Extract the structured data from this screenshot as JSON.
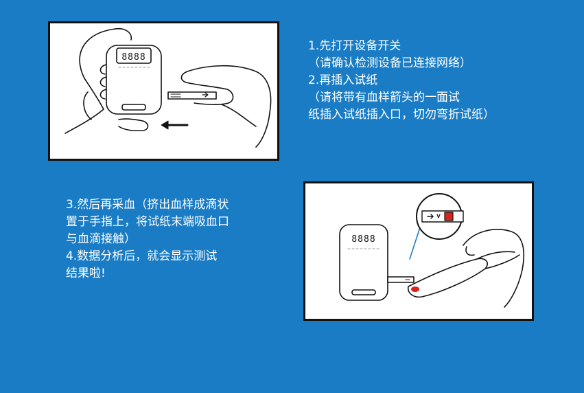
{
  "step_a": {
    "lines": [
      "1.先打开设备开关",
      "（请确认检测设备已连接网络）",
      "2.再插入试纸",
      "（请将带有血样箭头的一面试",
      "纸插入试纸插入口，切勿弯折试纸）"
    ]
  },
  "step_b": {
    "lines": [
      "3.然后再采血（挤出血样成滴状",
      "置于手指上，将试纸末端吸血口",
      "与血滴接触）",
      "4.数据分析后，就会显示测试",
      "结果啦!"
    ]
  },
  "illustration": {
    "display_readout": "8888"
  },
  "colors": {
    "background": "#1a7cc4",
    "panel": "#ffffff",
    "outline": "#111111",
    "accent_red": "#d9241c"
  }
}
